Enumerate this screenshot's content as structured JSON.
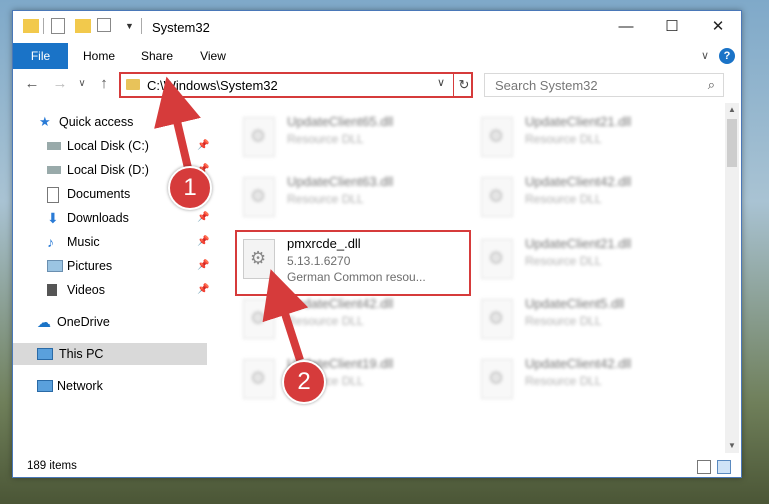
{
  "window": {
    "title": "System32",
    "controls": {
      "minimize": "—",
      "maximize": "☐",
      "close": "✕"
    }
  },
  "ribbon": {
    "file": "File",
    "tabs": [
      "Home",
      "Share",
      "View"
    ],
    "expand": "∨",
    "help": "?"
  },
  "nav": {
    "back": "←",
    "forward": "→",
    "recent": "∨",
    "up": "↑"
  },
  "address": {
    "path": "C:\\Windows\\System32",
    "dropdown": "∨",
    "refresh": "↻"
  },
  "search": {
    "placeholder": "Search System32",
    "icon": "search-icon"
  },
  "sidebar": {
    "items": [
      {
        "label": "Quick access",
        "icon": "star-icon",
        "pinned": false
      },
      {
        "label": "Local Disk (C:)",
        "icon": "drive-icon",
        "pinned": true
      },
      {
        "label": "Local Disk (D:)",
        "icon": "drive-icon",
        "pinned": true
      },
      {
        "label": "Documents",
        "icon": "documents-icon",
        "pinned": true
      },
      {
        "label": "Downloads",
        "icon": "downloads-icon",
        "pinned": true
      },
      {
        "label": "Music",
        "icon": "music-icon",
        "pinned": true
      },
      {
        "label": "Pictures",
        "icon": "pictures-icon",
        "pinned": true
      },
      {
        "label": "Videos",
        "icon": "videos-icon",
        "pinned": true
      },
      {
        "label": "OneDrive",
        "icon": "cloud-icon",
        "pinned": false
      },
      {
        "label": "This PC",
        "icon": "computer-icon",
        "pinned": false
      },
      {
        "label": "Network",
        "icon": "network-icon",
        "pinned": false
      }
    ]
  },
  "files": [
    {
      "name": "UpdateClient65.dll",
      "type": "Resource DLL",
      "blurred": true
    },
    {
      "name": "UpdateClient21.dll",
      "type": "Resource DLL",
      "blurred": true
    },
    {
      "name": "UpdateClient63.dll",
      "type": "Resource DLL",
      "blurred": true
    },
    {
      "name": "UpdateClient42.dll",
      "type": "Resource DLL",
      "blurred": true
    },
    {
      "name": "pmxrcde_.dll",
      "version": "5.13.1.6270",
      "type": "German Common resou...",
      "blurred": false
    },
    {
      "name": "UpdateClient21.dll",
      "type": "Resource DLL",
      "blurred": true
    },
    {
      "name": "UpdateClient42.dll",
      "type": "Resource DLL",
      "blurred": true
    },
    {
      "name": "UpdateClient5.dll",
      "type": "Resource DLL",
      "blurred": true
    },
    {
      "name": "UpdateClient19.dll",
      "type": "Resource DLL",
      "blurred": true
    },
    {
      "name": "UpdateClient42.dll",
      "type": "Resource DLL",
      "blurred": true
    }
  ],
  "status": {
    "count": "189 items"
  },
  "callouts": [
    "1",
    "2"
  ],
  "colors": {
    "accent": "#1a73c7",
    "callout": "#d63b3b"
  }
}
